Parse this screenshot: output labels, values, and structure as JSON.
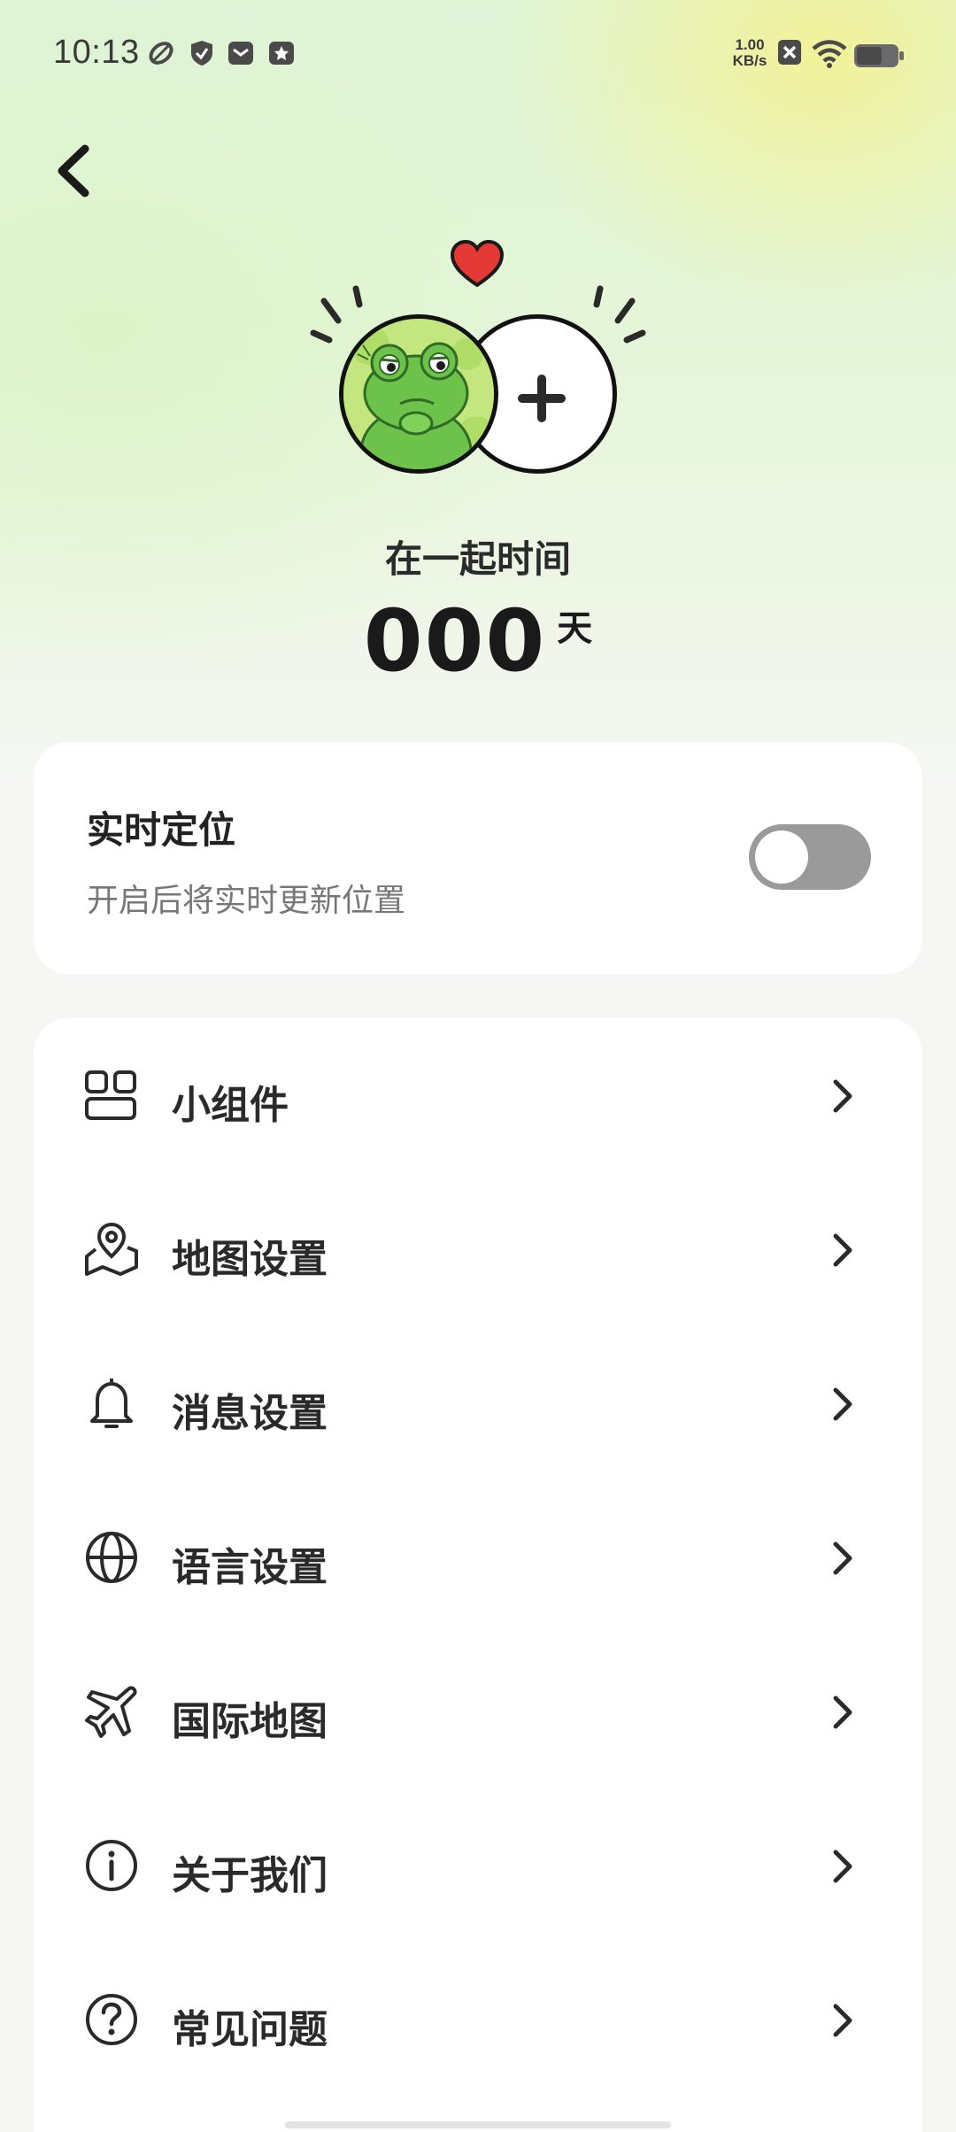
{
  "status_bar": {
    "time": "10:13",
    "net_speed_value": "1.00",
    "net_speed_unit": "KB/s"
  },
  "header": {
    "back_icon": "chevron-left-icon"
  },
  "couple": {
    "together_label": "在一起时间",
    "days_count": "000",
    "days_unit": "天"
  },
  "location": {
    "title": "实时定位",
    "subtitle": "开启后将实时更新位置",
    "enabled": false
  },
  "menu": {
    "items": [
      {
        "label": "小组件",
        "icon": "widget-icon"
      },
      {
        "label": "地图设置",
        "icon": "map-pin-icon"
      },
      {
        "label": "消息设置",
        "icon": "bell-icon"
      },
      {
        "label": "语言设置",
        "icon": "globe-icon"
      },
      {
        "label": "国际地图",
        "icon": "airplane-icon"
      },
      {
        "label": "关于我们",
        "icon": "info-icon"
      },
      {
        "label": "常见问题",
        "icon": "question-icon"
      }
    ]
  },
  "colors": {
    "toggle_off": "#9a9a9a",
    "heart": "#e53935",
    "frog_green": "#6cc24a"
  }
}
